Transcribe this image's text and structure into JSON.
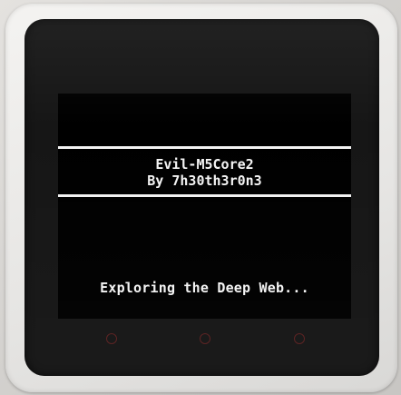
{
  "screen": {
    "title": "Evil-M5Core2",
    "author": "By 7h30th3r0n3",
    "status": "Exploring the Deep Web..."
  },
  "colors": {
    "screen_background": "#000000",
    "text": "#f4f4f4",
    "divider": "#f2f2f2",
    "touch_button_ring": "#5a2020",
    "device_shell": "#ecebe9"
  },
  "buttons": [
    {
      "name": "touch-button-a",
      "icon": "circle-ring"
    },
    {
      "name": "touch-button-b",
      "icon": "circle-ring"
    },
    {
      "name": "touch-button-c",
      "icon": "circle-ring"
    }
  ]
}
